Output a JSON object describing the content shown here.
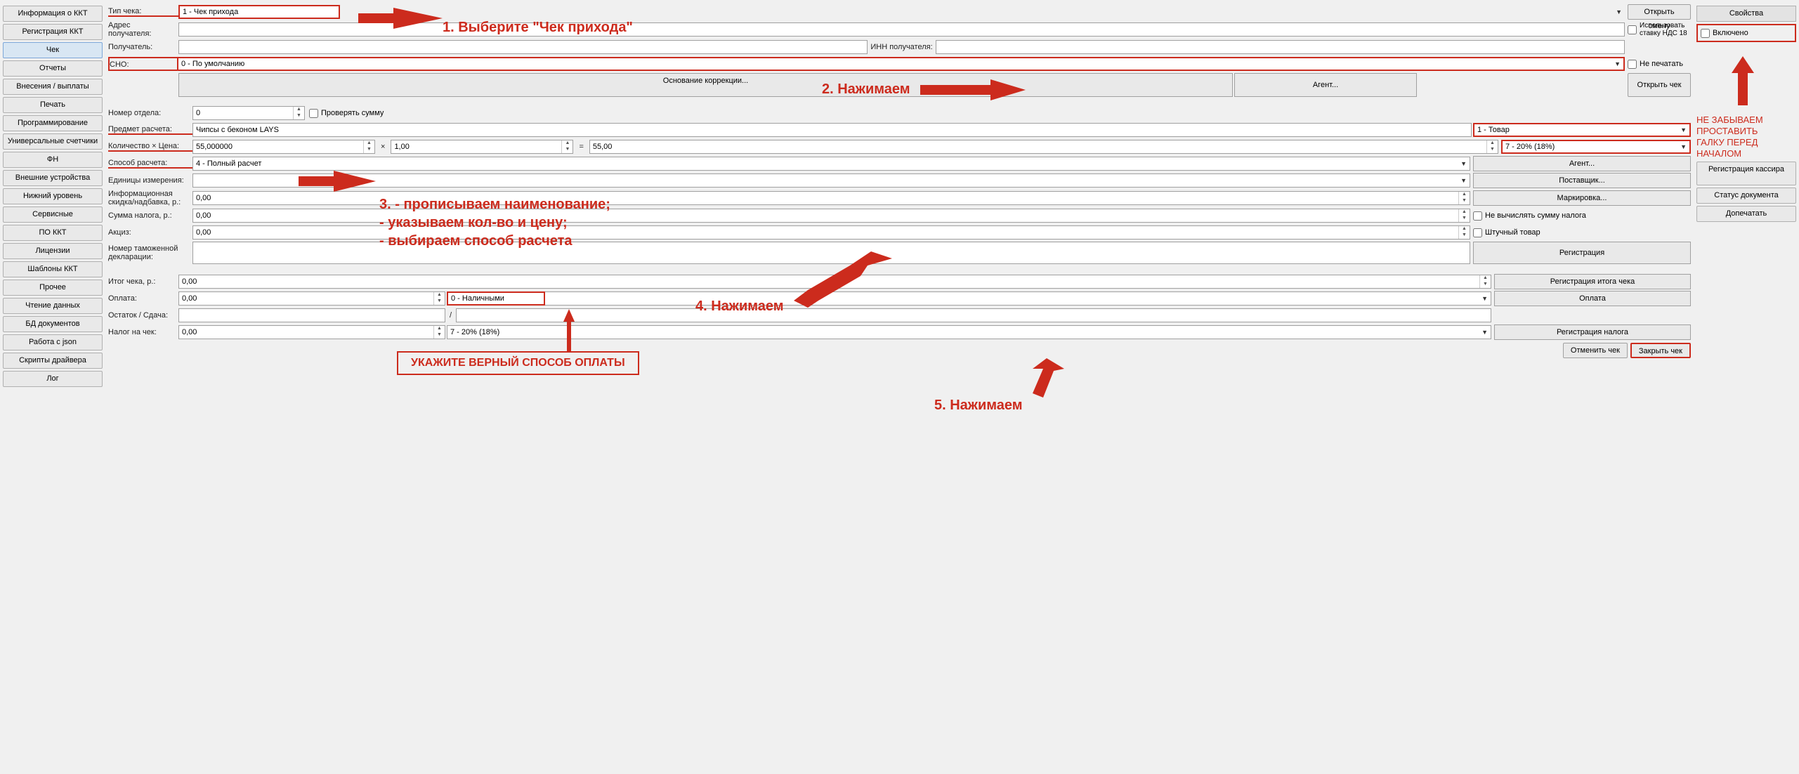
{
  "sidebar_left": {
    "items": [
      "Информация о ККТ",
      "Регистрация ККТ",
      "Чек",
      "Отчеты",
      "Внесения / выплаты",
      "Печать",
      "Программирование",
      "Универсальные счетчики",
      "ФН",
      "Внешние устройства",
      "Нижний уровень",
      "Сервисные",
      "ПО ККТ",
      "Лицензии",
      "Шаблоны ККТ",
      "Прочее",
      "Чтение данных",
      "БД документов",
      "Работа с json",
      "Скрипты драйвера",
      "Лог"
    ],
    "active_index": 2
  },
  "header": {
    "type_label": "Тип чека:",
    "type_value": "1 - Чек прихода",
    "addr_label": "Адрес получателя:",
    "recipient_label": "Получатель:",
    "inn_label": "ИНН получателя:",
    "sno_label": "СНО:",
    "sno_value": "0 - По умолчанию",
    "vat18_label": "Использовать ставку НДС 18",
    "no_print_label": "Не печатать",
    "open_shift": "Открыть смену",
    "open_check": "Открыть чек",
    "basis_label": "Основание коррекции...",
    "agent_btn": "Агент..."
  },
  "item": {
    "dept_label": "Номер отдела:",
    "dept_value": "0",
    "check_sum_label": "Проверять сумму",
    "subject_label": "Предмет расчета:",
    "subject_value": "Чипсы с беконом LAYS",
    "subject_type": "1 - Товар",
    "qty_price_label": "Количество × Цена:",
    "qty_value": "55,000000",
    "times": "×",
    "price_value": "1,00",
    "eq": "=",
    "total_value": "55,00",
    "tax_rate": "7 - 20% (18%)",
    "method_label": "Способ расчета:",
    "method_value": "4 - Полный расчет",
    "agent_btn": "Агент...",
    "unit_label": "Единицы измерения:",
    "supplier_btn": "Поставщик...",
    "discount_label": "Информационная скидка/надбавка, р.:",
    "discount_value": "0,00",
    "marking_btn": "Маркировка...",
    "tax_sum_label": "Сумма налога, р.:",
    "tax_sum_value": "0,00",
    "no_calc_tax": "Не вычислять сумму налога",
    "excise_label": "Акциз:",
    "excise_value": "0,00",
    "piece_goods": "Штучный товар",
    "customs_label": "Номер таможенной декларации:",
    "register_btn": "Регистрация"
  },
  "footer": {
    "total_label": "Итог чека, р.:",
    "total_value": "0,00",
    "reg_total_btn": "Регистрация итога чека",
    "payment_label": "Оплата:",
    "payment_value": "0,00",
    "payment_type": "0 - Наличными",
    "payment_btn": "Оплата",
    "change_label": "Остаток / Сдача:",
    "change_sep": "/",
    "tax_check_label": "Налог на чек:",
    "tax_check_value": "0,00",
    "tax_check_rate": "7 - 20% (18%)",
    "reg_tax_btn": "Регистрация налога",
    "cancel_btn": "Отменить чек",
    "close_btn": "Закрыть чек"
  },
  "sidebar_right": {
    "properties": "Свойства",
    "enabled": "Включено",
    "reg_cashier": "Регистрация кассира",
    "doc_status": "Статус документа",
    "reprint": "Допечатать"
  },
  "annotations": {
    "a1": "1. Выберите \"Чек прихода\"",
    "a2": "2. Нажимаем",
    "a3_line1": "3. - прописываем наименование;",
    "a3_line2": "    - указываем кол-во и цену;",
    "a3_line3": "    - выбираем способ расчета",
    "a4": "4. Нажимаем",
    "a5": "5. Нажимаем",
    "payment_note": "УКАЖИТЕ ВЕРНЫЙ СПОСОБ ОПЛАТЫ",
    "right_note_l1": "НЕ ЗАБЫВАЕМ",
    "right_note_l2": "ПРОСТАВИТЬ",
    "right_note_l3": "ГАЛКУ ПЕРЕД",
    "right_note_l4": "НАЧАЛОМ"
  }
}
